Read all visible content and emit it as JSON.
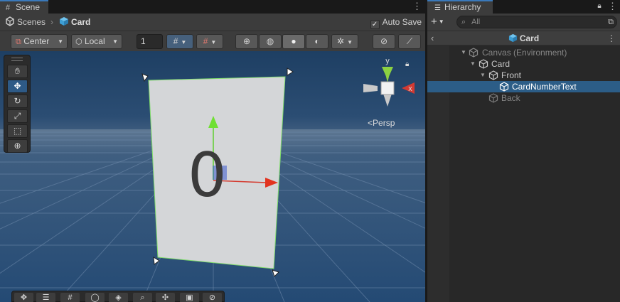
{
  "scene": {
    "tab_label": "Scene",
    "breadcrumb": {
      "root": "Scenes",
      "current": "Card"
    },
    "auto_save_label": "Auto Save",
    "auto_save_checked": true,
    "toolbar": {
      "pivot_mode": "Center",
      "pivot_rotation": "Local",
      "snap_value": "1"
    },
    "view_label": "Persp",
    "gizmo_axes": {
      "x": "x",
      "y": "y"
    },
    "card_number": "0"
  },
  "hierarchy": {
    "tab_label": "Hierarchy",
    "search_placeholder": "All",
    "scene_title": "Card",
    "items": [
      {
        "label": "Canvas (Environment)",
        "depth": 0,
        "dim": true,
        "expanded": true
      },
      {
        "label": "Card",
        "depth": 1,
        "dim": false,
        "expanded": true
      },
      {
        "label": "Front",
        "depth": 2,
        "dim": false,
        "expanded": true
      },
      {
        "label": "CardNumberText",
        "depth": 3,
        "dim": false,
        "selected": true
      },
      {
        "label": "Back",
        "depth": 2,
        "dim": true
      }
    ]
  },
  "colors": {
    "accent": "#3a79bb",
    "selection": "#2c5d87",
    "panel": "#282828",
    "toolbar": "#3c3c3c",
    "axis_x": "#d43a2e",
    "axis_y": "#5fcf2f",
    "axis_z": "#3b5bd0"
  }
}
